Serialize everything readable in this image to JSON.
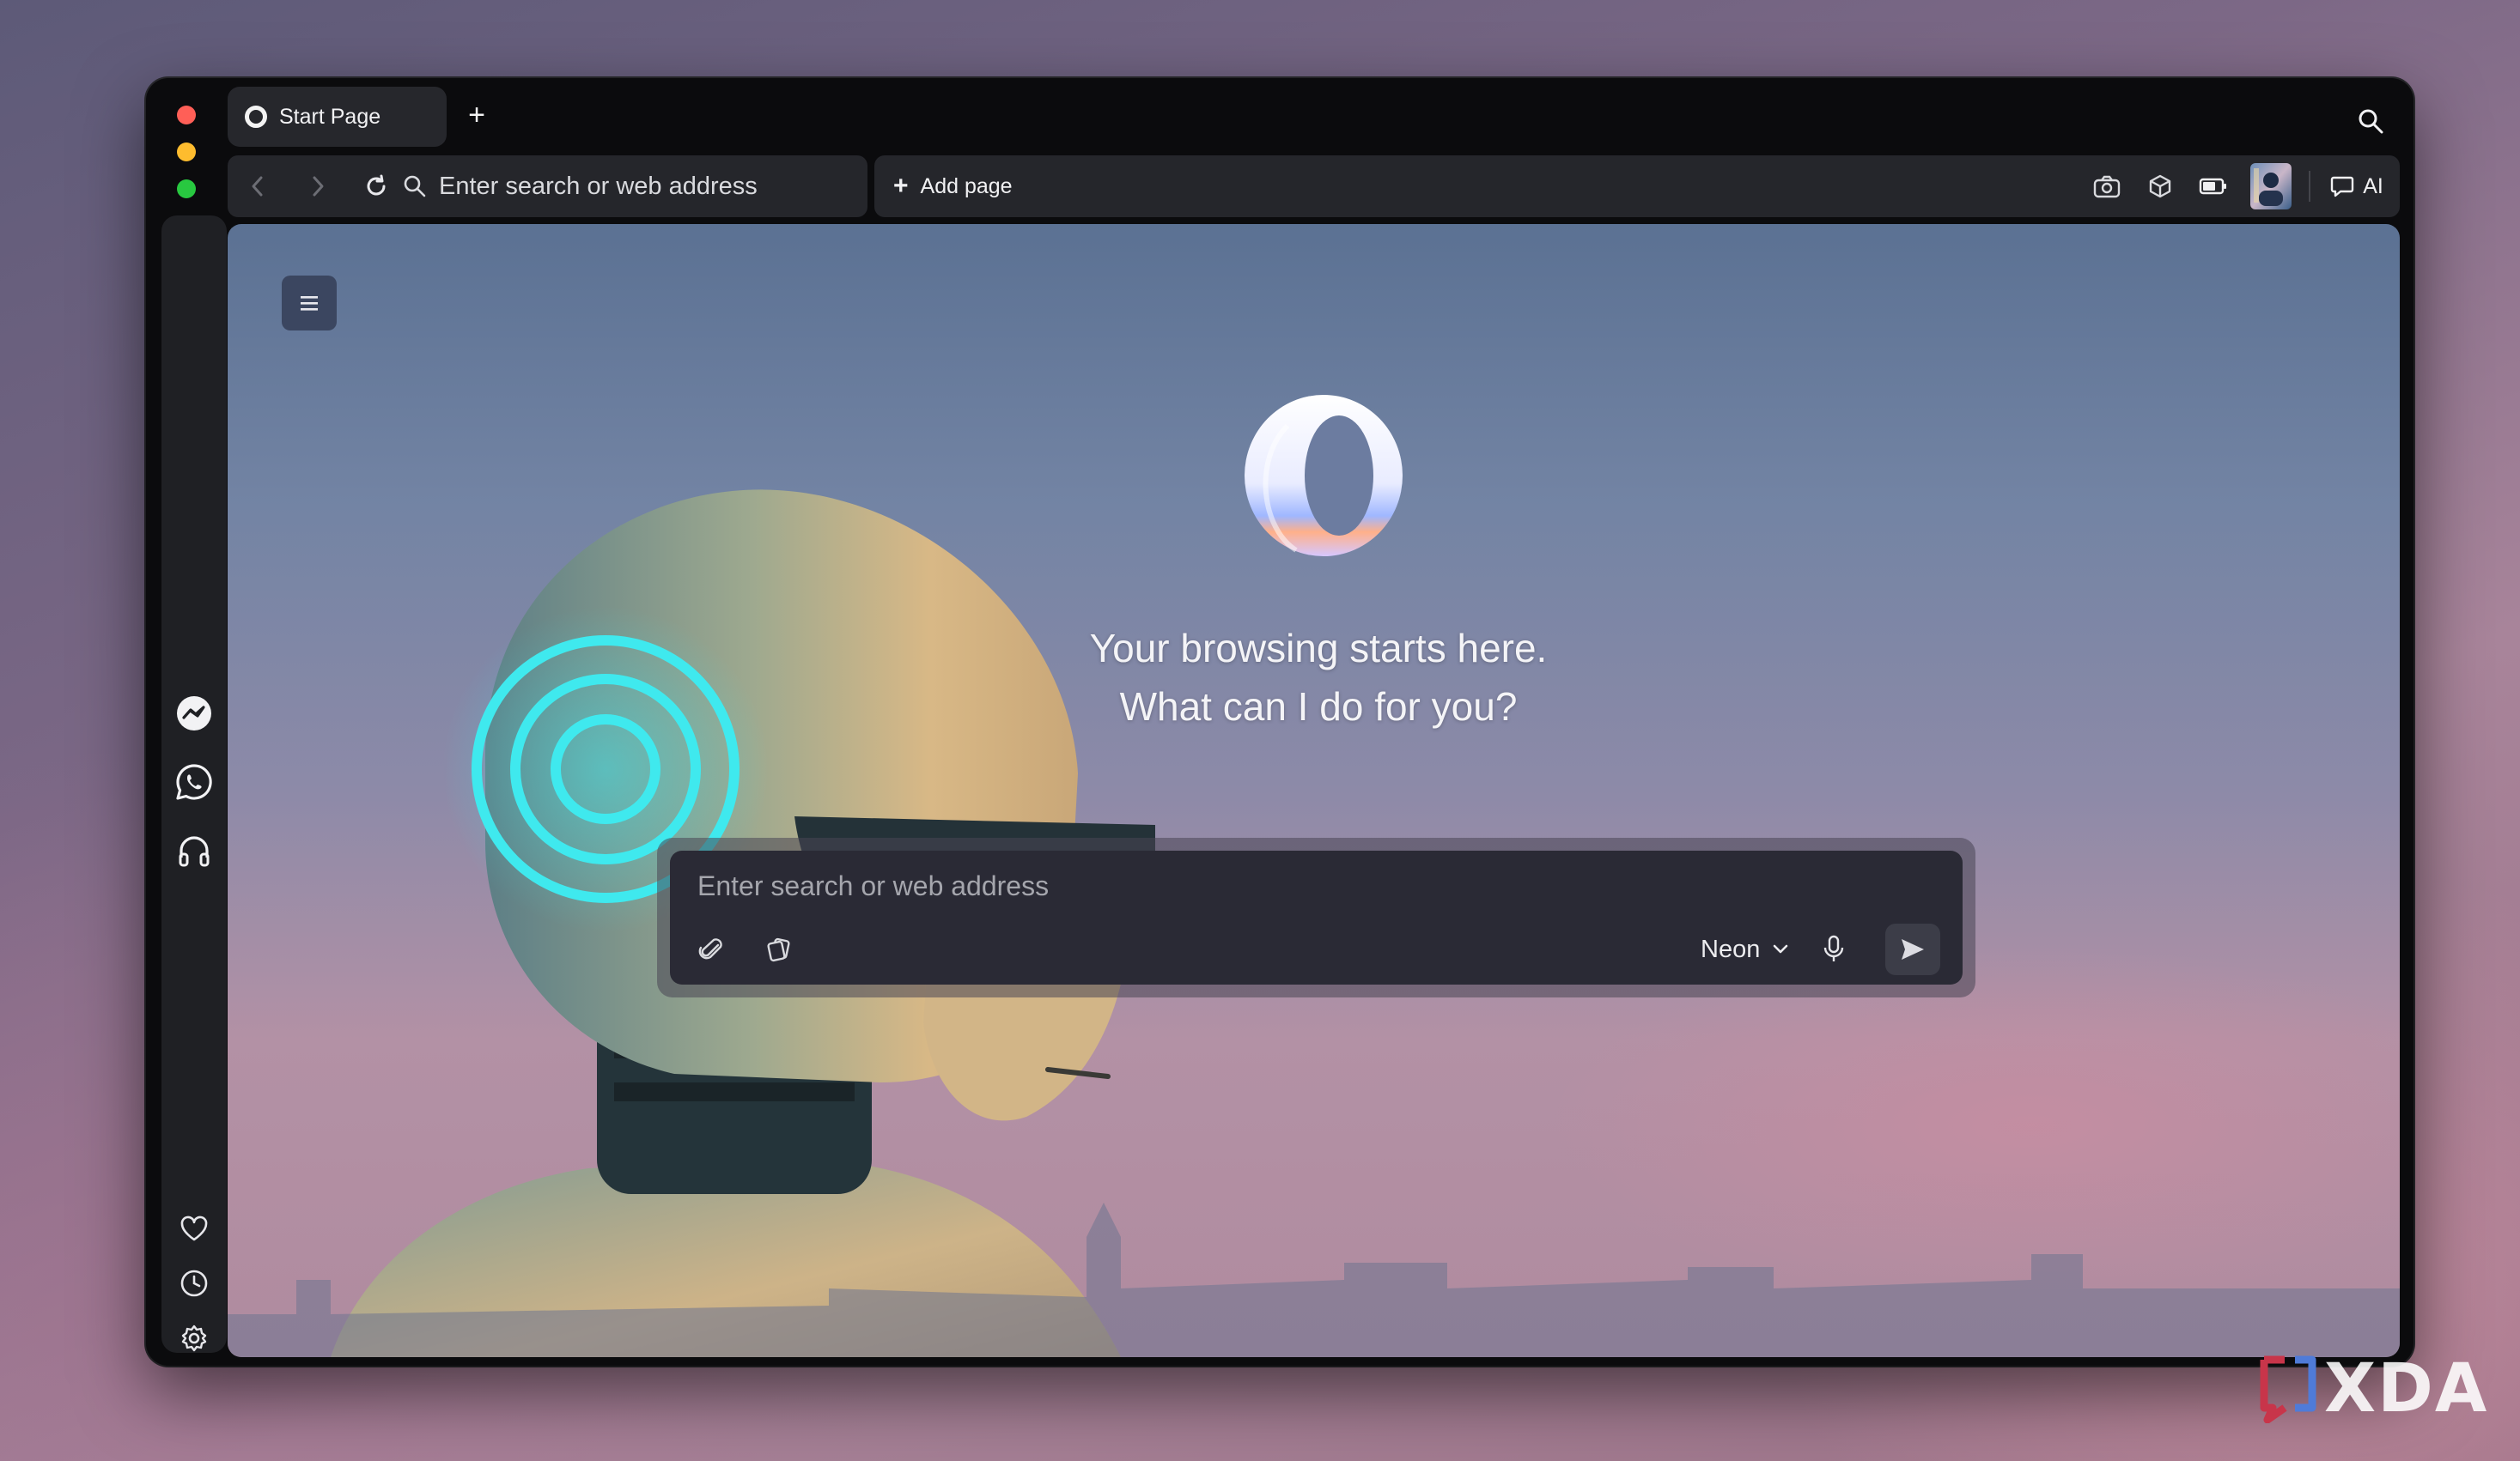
{
  "window": {
    "tab_title": "Start Page",
    "new_tab_label": "+"
  },
  "toolbar": {
    "address_placeholder": "Enter search or web address",
    "add_page_label": "Add page",
    "ai_label": "AI"
  },
  "sidebar": {
    "items": [
      "messenger-icon",
      "whatsapp-icon",
      "music-icon",
      "heart-icon",
      "history-icon",
      "settings-icon",
      "more-icon"
    ]
  },
  "main": {
    "headline_line1": "Your browsing starts here.",
    "headline_line2": "What can I do for you?",
    "search_placeholder": "Enter search or web address",
    "model_selected": "Neon"
  },
  "watermark": {
    "brand_text": "XDA"
  },
  "colors": {
    "accent_cyan": "#3fe9ee",
    "toolbar_bg": "#25262b",
    "window_bg": "#0b0b0d"
  }
}
